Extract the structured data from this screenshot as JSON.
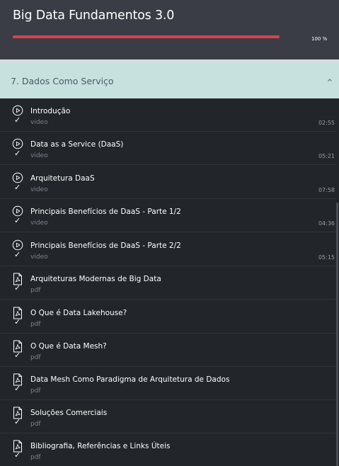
{
  "course": {
    "title": "Big Data Fundamentos 3.0",
    "progress_label": "100 %",
    "progress": 1.0
  },
  "section": {
    "title": "7. Dados Como Serviço",
    "expanded": true
  },
  "lessons": [
    {
      "title": "Introdução",
      "type": "video",
      "duration": "02:55",
      "icon": "play-circle-icon",
      "completed": true
    },
    {
      "title": "Data as a Service (DaaS)",
      "type": "video",
      "duration": "05:21",
      "icon": "play-circle-icon",
      "completed": true
    },
    {
      "title": "Arquitetura DaaS",
      "type": "video",
      "duration": "07:58",
      "icon": "play-circle-icon",
      "completed": true
    },
    {
      "title": "Principais Benefícios de DaaS - Parte 1/2",
      "type": "video",
      "duration": "04:36",
      "icon": "play-circle-icon",
      "completed": true
    },
    {
      "title": "Principais Benefícios de DaaS - Parte 2/2",
      "type": "video",
      "duration": "05:15",
      "icon": "play-circle-icon",
      "completed": true
    },
    {
      "title": "Arquiteturas Modernas de Big Data",
      "type": "pdf",
      "duration": "",
      "icon": "pdf-icon",
      "completed": true
    },
    {
      "title": "O Que é Data Lakehouse?",
      "type": "pdf",
      "duration": "",
      "icon": "pdf-icon",
      "completed": true
    },
    {
      "title": "O Que é Data Mesh?",
      "type": "pdf",
      "duration": "",
      "icon": "pdf-icon",
      "completed": true
    },
    {
      "title": "Data Mesh Como Paradigma de Arquitetura de Dados",
      "type": "pdf",
      "duration": "",
      "icon": "pdf-icon",
      "completed": true
    },
    {
      "title": "Soluções Comerciais",
      "type": "pdf",
      "duration": "",
      "icon": "pdf-icon",
      "completed": true
    },
    {
      "title": "Bibliografia, Referências e Links Úteis",
      "type": "pdf",
      "duration": "",
      "icon": "pdf-icon",
      "completed": true
    }
  ],
  "colors": {
    "header_bg": "#3a3d45",
    "progress": "#d9434e",
    "section_bg": "#c7e1df",
    "list_bg": "#22252a"
  }
}
